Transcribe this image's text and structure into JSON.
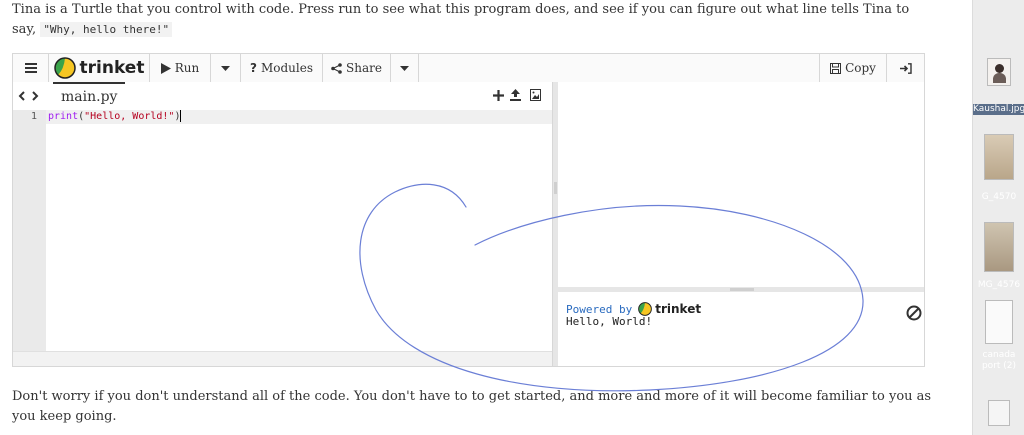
{
  "intro": {
    "text": "Tina is a Turtle that you control with code. Press run to see what this program does, and see if you can figure out what line tells Tina to say, ",
    "code": "\"Why, hello there!\""
  },
  "toolbar": {
    "logo": "trinket",
    "run_label": "Run",
    "modules_label": "Modules",
    "share_label": "Share",
    "copy_label": "Copy"
  },
  "editor": {
    "filename": "main.py",
    "lines": [
      {
        "number": "1",
        "keyword": "print",
        "open": "(",
        "string": "\"Hello, World!\"",
        "close": ")"
      }
    ]
  },
  "console": {
    "powered_by": "Powered by",
    "brand": "trinket",
    "output": "Hello, World!"
  },
  "outro": {
    "text": "Don't worry if you don't understand all of the code. You don't have to to get started, and more and more of it will become familiar to you as you keep going."
  },
  "desktop": {
    "files": [
      {
        "name": "Kaushal.jpg"
      },
      {
        "name": "G_4570"
      },
      {
        "name": "MG_4576"
      },
      {
        "name": "canada port (2)"
      }
    ]
  },
  "colors": {
    "keyword": "#a020f0",
    "string": "#b5001f",
    "powered": "#2a6bbf",
    "scribble": "#6b7fd6"
  }
}
